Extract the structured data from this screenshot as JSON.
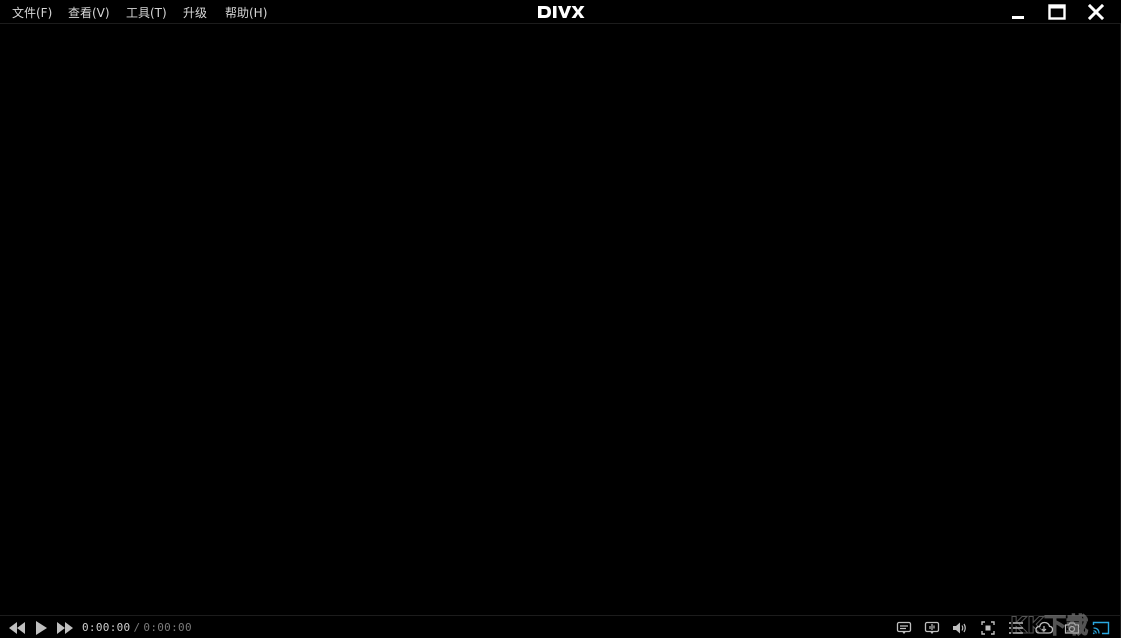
{
  "window": {
    "brand_logo_text": "DIVX",
    "menu": [
      {
        "label": "文件(F)"
      },
      {
        "label": "查看(V)"
      },
      {
        "label": "工具(T)"
      },
      {
        "label": "升级"
      },
      {
        "label": "帮助(H)"
      }
    ]
  },
  "controls": {
    "current_time": "0:00:00",
    "separator": "/",
    "duration": "0:00:00"
  },
  "icons": {
    "rewind": "rewind-icon",
    "play": "play-icon",
    "fast_forward": "fast-forward-icon",
    "subtitles": "subtitles-icon",
    "audio_track": "audio-track-icon",
    "volume": "volume-icon",
    "fullscreen": "fullscreen-icon",
    "playlist": "playlist-icon",
    "cloud": "cloud-icon",
    "snapshot": "camera-icon",
    "cast": "cast-icon"
  },
  "colors": {
    "background": "#000000",
    "menu_text": "#d6d6d6",
    "icon": "#bfbfbf",
    "accent": "#2aa8e0"
  },
  "watermark_text": "KK下载"
}
